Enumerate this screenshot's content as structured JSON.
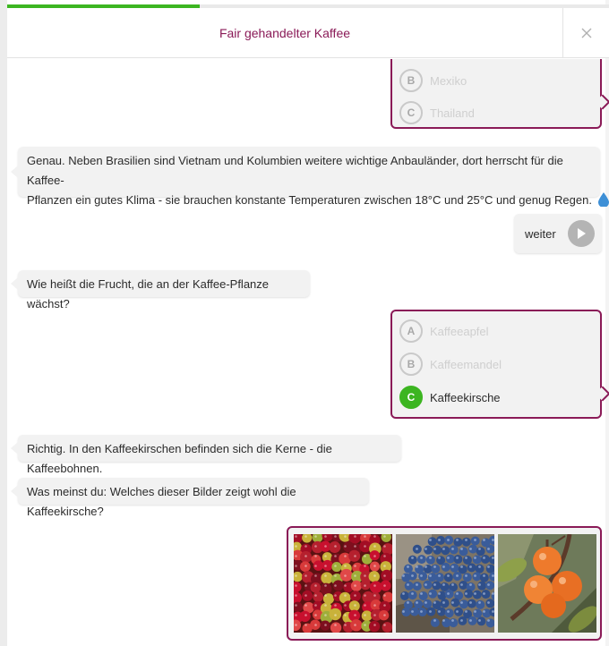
{
  "progress": {
    "fraction": 0.32
  },
  "header": {
    "title": "Fair gehandelter Kaffee",
    "close_icon": "close-icon"
  },
  "prev_question": {
    "options": [
      {
        "letter": "B",
        "label": "Mexiko"
      },
      {
        "letter": "C",
        "label": "Thailand"
      }
    ]
  },
  "messages": {
    "feedback1_line1": "Genau. Neben Brasilien sind Vietnam und Kolumbien weitere wichtige Anbauländer, dort herrscht für die Kaffee-",
    "feedback1_line2": "Pflanzen ein gutes Klima - sie brauchen konstante Temperaturen zwischen 18°C und 25°C und genug Regen.",
    "weiter": "weiter",
    "question2": "Wie heißt die Frucht, die an der Kaffee-Pflanze wächst?",
    "feedback2": "Richtig. In den Kaffeekirschen befinden sich die Kerne - die Kaffeebohnen.",
    "question3": "Was meinst du: Welches dieser Bilder zeigt wohl die Kaffeekirsche?"
  },
  "question2_options": [
    {
      "letter": "A",
      "label": "Kaffeeapfel",
      "selected": false
    },
    {
      "letter": "B",
      "label": "Kaffeemandel",
      "selected": false
    },
    {
      "letter": "C",
      "label": "Kaffeekirsche",
      "selected": true
    }
  ],
  "image_choices": [
    "coffee-cherries-image",
    "blueberries-image",
    "orange-berries-image"
  ],
  "colors": {
    "accent": "#8a1a57",
    "correct": "#3cb521",
    "bubble": "#f2f2f2",
    "water_drop": "#3d8fd6"
  }
}
